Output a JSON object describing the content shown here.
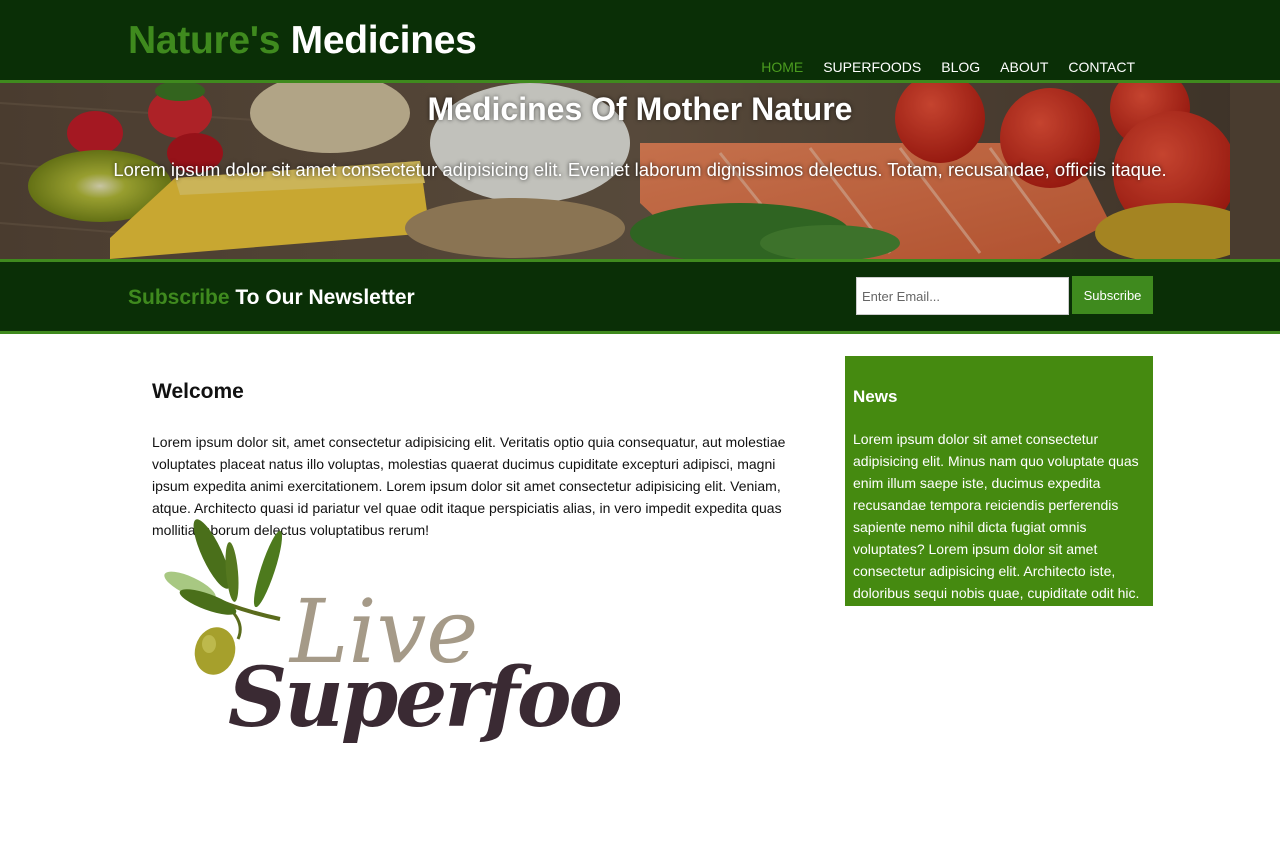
{
  "header": {
    "logo_highlight": "Nature's",
    "logo_rest": "Medicines",
    "nav": [
      {
        "label": "HOME",
        "active": true
      },
      {
        "label": "SUPERFOODS",
        "active": false
      },
      {
        "label": "BLOG",
        "active": false
      },
      {
        "label": "ABOUT",
        "active": false
      },
      {
        "label": "CONTACT",
        "active": false
      }
    ]
  },
  "hero": {
    "title": "Medicines Of Mother Nature",
    "text": "Lorem ipsum dolor sit amet consectetur adipisicing elit. Eveniet laborum dignissimos delectus. Totam, recusandae, officiis itaque."
  },
  "newsletter": {
    "title_highlight": "Subscribe",
    "title_rest": "To Our Newsletter",
    "email_placeholder": "Enter Email...",
    "email_value": "",
    "button_label": "Subscribe"
  },
  "main": {
    "title": "Welcome",
    "text": "Lorem ipsum dolor sit, amet consectetur adipisicing elit. Veritatis optio quia consequatur, aut molestiae voluptates placeat natus illo voluptas, molestias quaerat ducimus cupiditate excepturi adipisci, magni ipsum expedita animi exercitationem. Lorem ipsum dolor sit amet consectetur adipisicing elit. Veniam, atque. Architecto quasi id pariatur vel quae odit itaque perspiciatis alias, in vero impedit expedita quas mollitia laborum delectus voluptatibus rerum!",
    "logo_word1": "Live",
    "logo_word2": "Superfoods"
  },
  "sidebar": {
    "title": "News",
    "text": "Lorem ipsum dolor sit amet consectetur adipisicing elit. Minus nam quo voluptate quas enim illum saepe iste, ducimus expedita recusandae tempora reiciendis perferendis sapiente nemo nihil dicta fugiat omnis voluptates? Lorem ipsum dolor sit amet consectetur adipisicing elit. Architecto iste, doloribus sequi nobis quae, cupiditate odit hic."
  },
  "colors": {
    "dark_green": "#0a2f06",
    "accent_green": "#3f8a1e",
    "sidebar_green": "#458a10"
  }
}
